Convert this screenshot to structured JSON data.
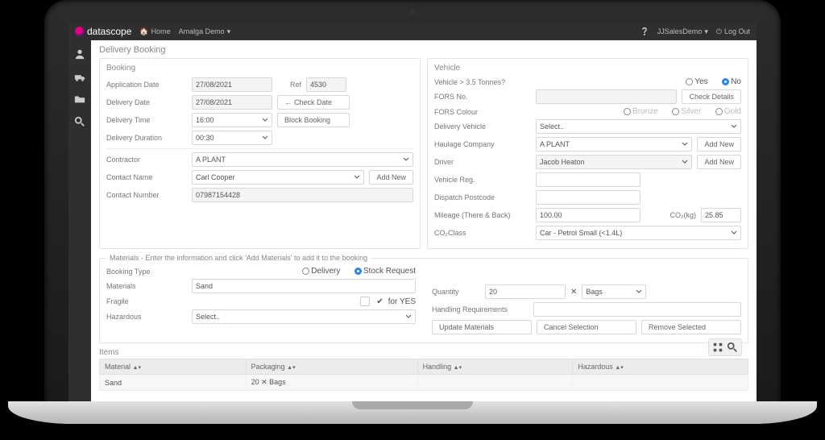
{
  "brand": "datascope",
  "nav": {
    "home": "Home",
    "project": "Amalga Demo",
    "user": "JJSalesDemo",
    "logout": "Log Out"
  },
  "page_title": "Delivery Booking",
  "booking": {
    "heading": "Booking",
    "app_date_lbl": "Application Date",
    "app_date": "27/08/2021",
    "ref_lbl": "Ref",
    "ref": "4530",
    "del_date_lbl": "Delivery Date",
    "del_date": "27/08/2021",
    "check_date_btn": "Check Date",
    "del_time_lbl": "Delivery Time",
    "del_time": "16:00",
    "block_btn": "Block Booking",
    "duration_lbl": "Delivery Duration",
    "duration": "00:30",
    "contractor_lbl": "Contractor",
    "contractor": "A PLANT",
    "contact_lbl": "Contact Name",
    "contact": "Carl Cooper",
    "add_new": "Add New",
    "phone_lbl": "Contact Number",
    "phone": "07987154428"
  },
  "vehicle": {
    "heading": "Vehicle",
    "over35_lbl": "Vehicle > 3.5 Tonnes?",
    "yes": "Yes",
    "no": "No",
    "fors_no_lbl": "FORS No.",
    "check_details": "Check Details",
    "fors_colour_lbl": "FORS Colour",
    "bronze": "Bronze",
    "silver": "Silver",
    "gold": "Gold",
    "veh_lbl": "Delivery Vehicle",
    "veh": "Select..",
    "haulage_lbl": "Haulage Company",
    "haulage": "A PLANT",
    "driver_lbl": "Driver",
    "driver": "Jacob Heaton",
    "reg_lbl": "Vehicle Reg.",
    "postcode_lbl": "Dispatch Postcode",
    "mileage_lbl": "Mileage (There & Back)",
    "mileage": "100.00",
    "co2_lbl": "CO₂(kg)",
    "co2": "25.85",
    "class_lbl": "CO₂Class",
    "class": "Car - Petrol Small (<1.4L)"
  },
  "materials": {
    "legend": "Materials - Enter the information and click 'Add Materials' to add it to the booking",
    "type_lbl": "Booking Type",
    "delivery": "Delivery",
    "stock": "Stock Request",
    "mat_lbl": "Materials",
    "mat": "Sand",
    "qty_lbl": "Quantity",
    "qty": "20",
    "unit": "Bags",
    "fragile_lbl": "Fragile",
    "for_yes": "for YES",
    "handling_lbl": "Handling Requirements",
    "haz_lbl": "Hazardous",
    "haz": "Select..",
    "update_btn": "Update Materials",
    "cancel_btn": "Cancel Selection",
    "remove_btn": "Remove Selected"
  },
  "items": {
    "heading": "Items",
    "cols": {
      "material": "Material",
      "packaging": "Packaging",
      "handling": "Handling",
      "hazardous": "Hazardous"
    },
    "row": {
      "material": "Sand",
      "packaging": "20 ✕ Bags",
      "handling": "",
      "hazardous": ""
    }
  }
}
